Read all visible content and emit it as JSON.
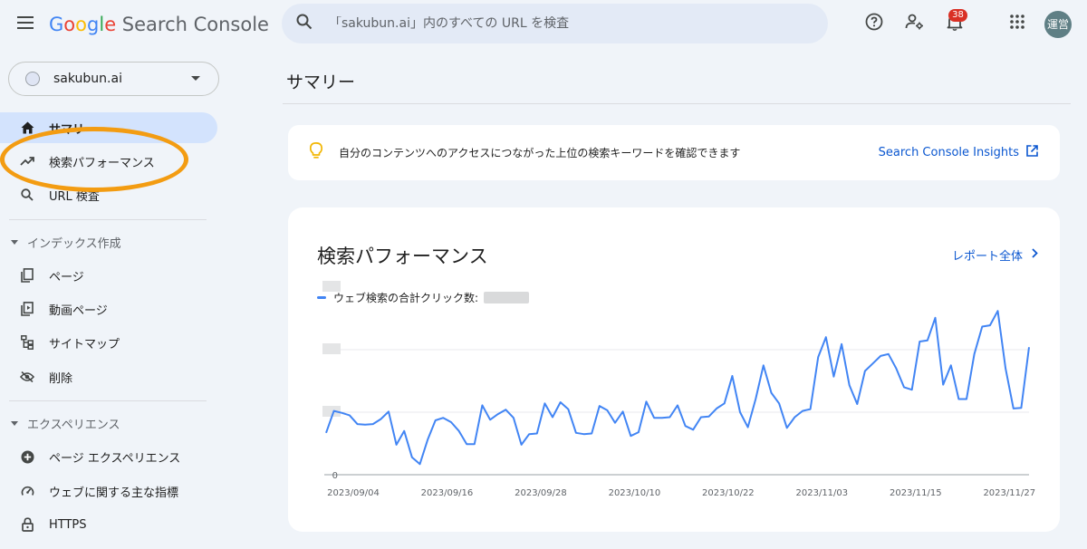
{
  "app": {
    "brand_letters": [
      "G",
      "o",
      "o",
      "g",
      "l",
      "e"
    ],
    "brand_rest": " Search Console"
  },
  "search": {
    "placeholder": "「sakubun.ai」内のすべての URL を検査"
  },
  "notifications": {
    "count": "38"
  },
  "avatar": {
    "label": "運営"
  },
  "property": {
    "name": "sakubun.ai"
  },
  "sidebar": {
    "items": [
      {
        "label": "サマリー",
        "icon": "home-icon",
        "active": true
      },
      {
        "label": "検索パフォーマンス",
        "icon": "trending-up-icon"
      },
      {
        "label": "URL 検査",
        "icon": "search-icon"
      }
    ],
    "sections": [
      {
        "title": "インデックス作成",
        "items": [
          {
            "label": "ページ",
            "icon": "pages-icon"
          },
          {
            "label": "動画ページ",
            "icon": "video-page-icon"
          },
          {
            "label": "サイトマップ",
            "icon": "sitemap-icon"
          },
          {
            "label": "削除",
            "icon": "removal-icon"
          }
        ]
      },
      {
        "title": "エクスペリエンス",
        "items": [
          {
            "label": "ページ エクスペリエンス",
            "icon": "page-experience-icon"
          },
          {
            "label": "ウェブに関する主な指標",
            "icon": "gauge-icon"
          },
          {
            "label": "HTTPS",
            "icon": "lock-icon"
          }
        ]
      }
    ]
  },
  "main": {
    "title": "サマリー",
    "insight": {
      "text": "自分のコンテンツへのアクセスにつながった上位の検索キーワードを確認できます",
      "link": "Search Console Insights"
    },
    "performance": {
      "title": "検索パフォーマンス",
      "report_link": "レポート全体",
      "legend": "ウェブ検索の合計クリック数:"
    }
  },
  "colors": {
    "accent": "#0b57d0",
    "series": "#4285f4",
    "highlight": "#f39c12",
    "active_nav": "#d3e3fd"
  },
  "chart_data": {
    "type": "line",
    "y_tick_labels": [
      "0"
    ],
    "x_tick_labels": [
      "2023/09/04",
      "2023/09/16",
      "2023/09/28",
      "2023/10/10",
      "2023/10/22",
      "2023/11/03",
      "2023/11/15",
      "2023/11/27"
    ],
    "ylim": [
      0,
      300
    ],
    "grid": true,
    "series": [
      {
        "values": [
          67,
          102,
          99,
          95,
          81,
          80,
          81,
          89,
          101,
          48,
          70,
          28,
          17,
          56,
          87,
          91,
          84,
          70,
          49,
          49,
          111,
          88,
          97,
          104,
          91,
          48,
          65,
          66,
          114,
          92,
          116,
          105,
          67,
          65,
          66,
          110,
          103,
          83,
          101,
          62,
          68,
          117,
          91,
          91,
          92,
          111,
          78,
          72,
          92,
          93,
          106,
          114,
          158,
          100,
          76,
          121,
          175,
          131,
          114,
          75,
          92,
          102,
          105,
          188,
          220,
          157,
          209,
          143,
          113,
          166,
          178,
          190,
          193,
          170,
          140,
          136,
          213,
          215,
          251,
          144,
          175,
          121,
          121,
          193,
          237,
          239,
          262,
          170,
          106,
          107,
          204
        ]
      }
    ]
  }
}
